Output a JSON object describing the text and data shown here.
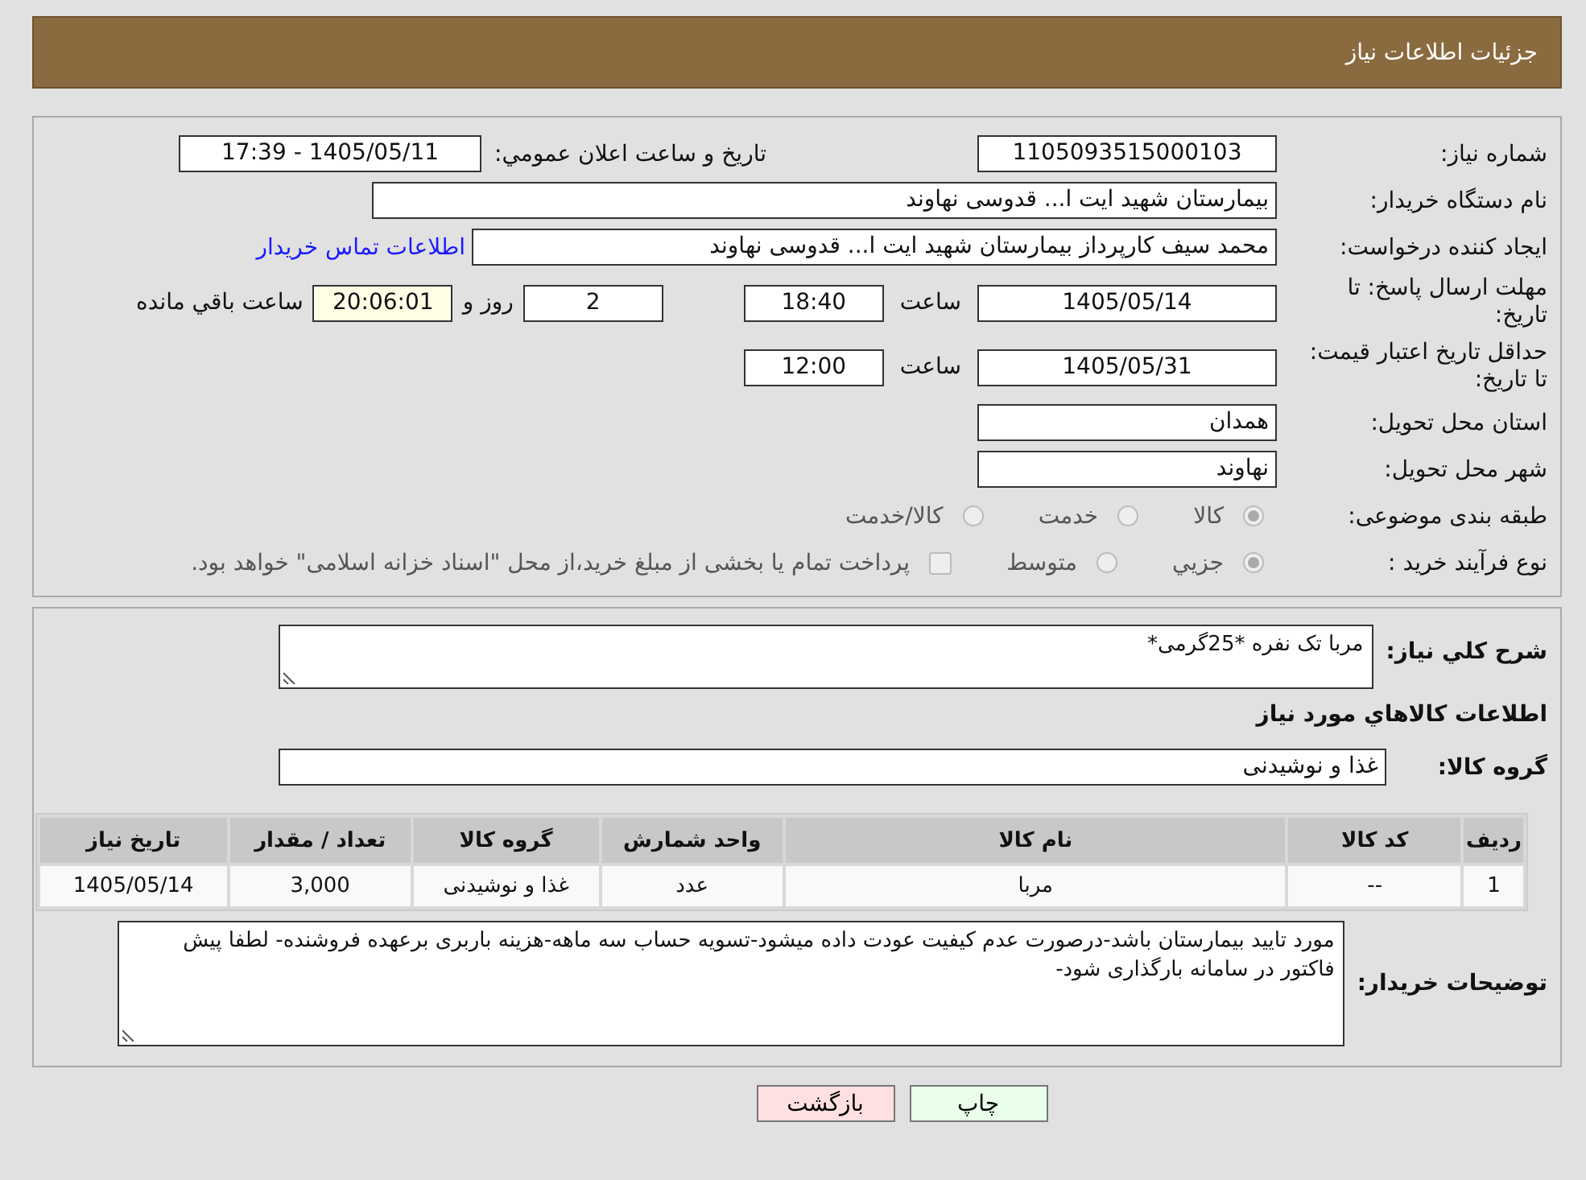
{
  "header": {
    "title": "جزئیات اطلاعات نیاز"
  },
  "need_number": {
    "label": "شماره نیاز:",
    "value": "1105093515000103"
  },
  "announce": {
    "label": "تاريخ و ساعت اعلان عمومي:",
    "value": "1405/05/11 - 17:39"
  },
  "buyer_org": {
    "label": "نام دستگاه خریدار:",
    "value": "بیمارستان شهید ایت ا... قدوسی نهاوند"
  },
  "requester": {
    "label": "ایجاد کننده درخواست:",
    "value": "محمد سیف کارپرداز بیمارستان شهید ایت ا... قدوسی نهاوند",
    "link": "اطلاعات تماس خریدار"
  },
  "response_deadline": {
    "label": "مهلت ارسال پاسخ: تا تاریخ:",
    "date": "1405/05/14",
    "time_label": "ساعت",
    "time": "18:40",
    "days": "2",
    "days_label": "روز و",
    "remaining": "20:06:01",
    "remaining_label": "ساعت باقي مانده"
  },
  "price_validity": {
    "label": "حداقل تاریخ اعتبار قیمت: تا تاریخ:",
    "date": "1405/05/31",
    "time_label": "ساعت",
    "time": "12:00"
  },
  "province": {
    "label": "استان محل تحویل:",
    "value": "همدان"
  },
  "city": {
    "label": "شهر محل تحویل:",
    "value": "نهاوند"
  },
  "category": {
    "label": "طبقه بندی موضوعی:",
    "options": [
      {
        "label": "کالا",
        "selected": true
      },
      {
        "label": "خدمت",
        "selected": false
      },
      {
        "label": "کالا/خدمت",
        "selected": false
      }
    ]
  },
  "process": {
    "label": "نوع فرآیند خرید :",
    "options": [
      {
        "label": "جزيي",
        "selected": true
      },
      {
        "label": "متوسط",
        "selected": false
      }
    ],
    "treasury": {
      "label": "پرداخت تمام یا بخشی از مبلغ خرید،از محل \"اسناد خزانه اسلامی\" خواهد بود.",
      "checked": false
    }
  },
  "description": {
    "label": "شرح كلي نياز:",
    "value": "مربا تک نفره *25گرمی*"
  },
  "goods_title": "اطلاعات كالاهاي مورد نياز",
  "goods_group": {
    "label": "گروه کالا:",
    "value": "غذا و نوشیدنی"
  },
  "table": {
    "columns": [
      "ردیف",
      "کد کالا",
      "نام کالا",
      "واحد شمارش",
      "گروه کالا",
      "تعداد / مقدار",
      "تاریخ نیاز"
    ],
    "rows": [
      [
        "1",
        "--",
        "مربا",
        "عدد",
        "غذا و نوشیدنی",
        "3,000",
        "1405/05/14"
      ]
    ]
  },
  "buyer_notes": {
    "label": "توضیحات خریدار:",
    "value": "مورد تایید بیمارستان باشد-درصورت عدم کیفیت عودت داده میشود-تسویه حساب سه ماهه-هزینه باربری برعهده فروشنده- لطفا پیش فاکتور در سامانه بارگذاری شود-"
  },
  "buttons": [
    {
      "kind": "print",
      "label": "چاپ"
    },
    {
      "kind": "back",
      "label": "بازگشت"
    }
  ]
}
